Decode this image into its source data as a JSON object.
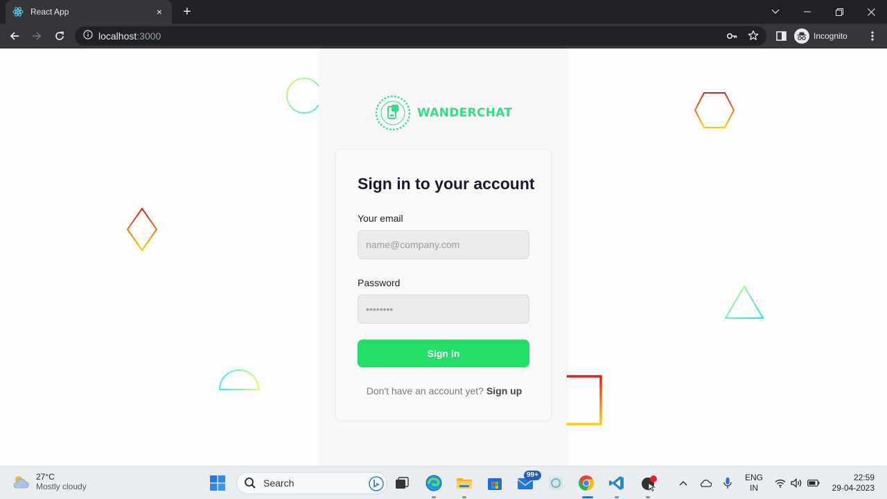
{
  "browser": {
    "tab_title": "React App",
    "tab_close": "×",
    "new_tab": "+",
    "url_host": "localhost",
    "url_port": ":3000",
    "profile_label": "Incognito"
  },
  "app": {
    "brand": "WANDERCHAT",
    "title": "Sign in to your account",
    "email_label": "Your email",
    "email_placeholder": "name@company.com",
    "password_label": "Password",
    "password_value": "••••••••",
    "submit_label": "Sign in",
    "signup_prompt": "Don't have an account yet?",
    "signup_link": "Sign up",
    "accent_color": "#22dd66"
  },
  "taskbar": {
    "weather_temp": "27°C",
    "weather_desc": "Mostly cloudy",
    "search_label": "Search",
    "mail_badge": "99+",
    "lang_top": "ENG",
    "lang_bottom": "IN",
    "time": "22:59",
    "date": "29-04-2023"
  }
}
